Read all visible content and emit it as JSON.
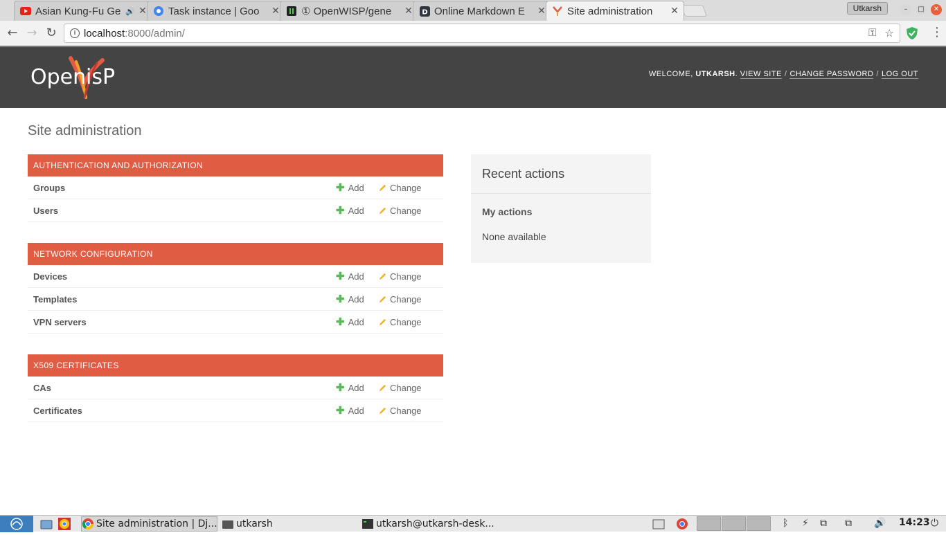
{
  "browser": {
    "tabs": [
      {
        "title": "Asian Kung-Fu Ge",
        "favicon": "youtube-icon",
        "audio": true
      },
      {
        "title": "Task instance | Goo",
        "favicon": "gear-icon",
        "audio": false
      },
      {
        "title": "① OpenWISP/gene",
        "favicon": "app-icon",
        "audio": false
      },
      {
        "title": "Online Markdown E",
        "favicon": "letter-d-icon",
        "audio": false
      },
      {
        "title": "Site administration",
        "favicon": "openwisp-icon",
        "audio": false
      }
    ],
    "profile": "Utkarsh",
    "url_host": "localhost",
    "url_rest": ":8000/admin/"
  },
  "header": {
    "welcome": "Welcome,",
    "username": "UTKARSH",
    "links": {
      "view_site": "View site",
      "change_password": "Change password",
      "log_out": "Log out"
    }
  },
  "page": {
    "title": "Site administration",
    "add_label": "Add",
    "change_label": "Change",
    "modules": [
      {
        "caption": "Authentication and Authorization",
        "models": [
          "Groups",
          "Users"
        ]
      },
      {
        "caption": "Network Configuration",
        "models": [
          "Devices",
          "Templates",
          "VPN servers"
        ]
      },
      {
        "caption": "X509 Certificates",
        "models": [
          "CAs",
          "Certificates"
        ]
      }
    ],
    "recent": {
      "title": "Recent actions",
      "subtitle": "My actions",
      "empty": "None available"
    }
  },
  "taskbar": {
    "tasks": [
      "Site administration | Dj...",
      "utkarsh",
      "utkarsh@utkarsh-desk..."
    ],
    "clock": "14:23"
  },
  "colors": {
    "brand": "#e05d44",
    "header_bg": "#444444",
    "add_green": "#5bb85b",
    "change_yellow": "#f0b429"
  }
}
